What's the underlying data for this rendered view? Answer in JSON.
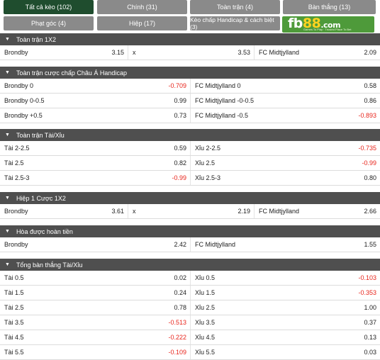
{
  "tabs": [
    {
      "label": "Tất cả kèo (102)",
      "active": true
    },
    {
      "label": "Chính (31)",
      "active": false
    },
    {
      "label": "Toàn trận (4)",
      "active": false
    },
    {
      "label": "Bàn thắng (13)",
      "active": false
    },
    {
      "label": "Phạt góc (4)",
      "active": false
    },
    {
      "label": "Hiệp (17)",
      "active": false
    },
    {
      "label": "Kèo chấp Handicap & cách biệt (3)",
      "active": false
    }
  ],
  "logo": {
    "brand_text": "fb88",
    "domain": ".com",
    "tagline": "Games To Play · Trusted Place To Bet"
  },
  "sections": [
    {
      "title": "Toàn trận 1X2",
      "rows": [
        [
          {
            "label": "Brondby",
            "odd": "3.15"
          },
          {
            "label": "x",
            "odd": "3.53"
          },
          {
            "label": "FC Midtjylland",
            "odd": "2.09"
          }
        ]
      ]
    },
    {
      "title": "Toàn trận cược chấp Châu Á Handicap",
      "rows": [
        [
          {
            "label": "Brondby 0",
            "odd": "-0.709"
          },
          {
            "label": "FC Midtjylland 0",
            "odd": "0.58"
          }
        ],
        [
          {
            "label": "Brondby 0-0.5",
            "odd": "0.99"
          },
          {
            "label": "FC Midtjylland -0-0.5",
            "odd": "0.86"
          }
        ],
        [
          {
            "label": "Brondby +0.5",
            "odd": "0.73"
          },
          {
            "label": "FC Midtjylland -0.5",
            "odd": "-0.893"
          }
        ]
      ]
    },
    {
      "title": "Toàn trận Tài/Xỉu",
      "rows": [
        [
          {
            "label": "Tài 2-2.5",
            "odd": "0.59"
          },
          {
            "label": "Xỉu 2-2.5",
            "odd": "-0.735"
          }
        ],
        [
          {
            "label": "Tài 2.5",
            "odd": "0.82"
          },
          {
            "label": "Xỉu 2.5",
            "odd": "-0.99"
          }
        ],
        [
          {
            "label": "Tài 2.5-3",
            "odd": "-0.99"
          },
          {
            "label": "Xỉu 2.5-3",
            "odd": "0.80"
          }
        ]
      ]
    },
    {
      "title": "Hiệp 1 Cược 1X2",
      "rows": [
        [
          {
            "label": "Brondby",
            "odd": "3.61"
          },
          {
            "label": "x",
            "odd": "2.19"
          },
          {
            "label": "FC Midtjylland",
            "odd": "2.66"
          }
        ]
      ]
    },
    {
      "title": "Hòa được hoàn tiền",
      "rows": [
        [
          {
            "label": "Brondby",
            "odd": "2.42"
          },
          {
            "label": "FC Midtjylland",
            "odd": "1.55"
          }
        ]
      ]
    },
    {
      "title": "Tổng bàn thắng Tài/Xỉu",
      "rows": [
        [
          {
            "label": "Tài 0.5",
            "odd": "0.02"
          },
          {
            "label": "Xỉu 0.5",
            "odd": "-0.103"
          }
        ],
        [
          {
            "label": "Tài 1.5",
            "odd": "0.24"
          },
          {
            "label": "Xỉu 1.5",
            "odd": "-0.353"
          }
        ],
        [
          {
            "label": "Tài 2.5",
            "odd": "0.78"
          },
          {
            "label": "Xỉu 2.5",
            "odd": "1.00"
          }
        ],
        [
          {
            "label": "Tài 3.5",
            "odd": "-0.513"
          },
          {
            "label": "Xỉu 3.5",
            "odd": "0.37"
          }
        ],
        [
          {
            "label": "Tài 4.5",
            "odd": "-0.222"
          },
          {
            "label": "Xỉu 4.5",
            "odd": "0.13"
          }
        ],
        [
          {
            "label": "Tài 5.5",
            "odd": "-0.109"
          },
          {
            "label": "Xỉu 5.5",
            "odd": "0.03"
          }
        ]
      ]
    }
  ],
  "colors": {
    "active_tab": "#1f4d2e",
    "tab": "#8a8a8a",
    "section_header": "#4f4f4f",
    "negative_odd": "#e8251c",
    "logo_bg": "#4e9a3a"
  },
  "icons": {
    "section_toggle": "chevron-down-icon"
  }
}
